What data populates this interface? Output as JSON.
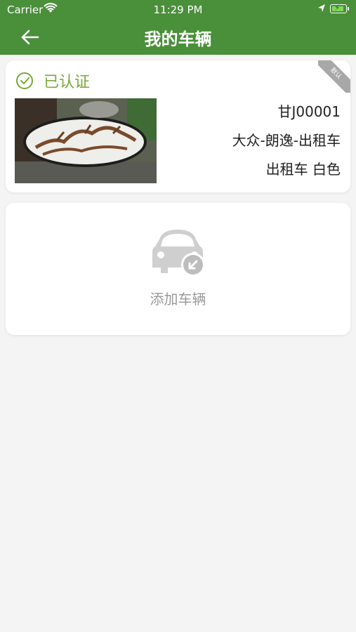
{
  "status": {
    "carrier": "Carrier",
    "time": "11:29 PM"
  },
  "header": {
    "title": "我的车辆"
  },
  "vehicle": {
    "status_label": "已认证",
    "default_tag": "默认",
    "plate": "甘J00001",
    "model": "大众-朗逸-出租车",
    "type_color": "出租车 白色"
  },
  "add": {
    "label": "添加车辆"
  },
  "colors": {
    "primary": "#4a8f3a",
    "verified": "#7aa83a"
  }
}
